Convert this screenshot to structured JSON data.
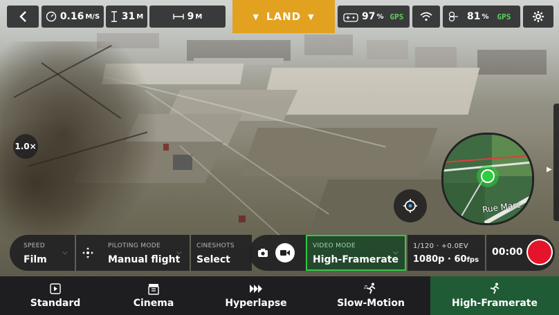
{
  "topbar": {
    "speed_value": "0.16",
    "speed_unit": "M/S",
    "altitude_value": "31",
    "altitude_unit": "M",
    "distance_value": "9",
    "distance_unit": "M",
    "land_label": "LAND",
    "controller_battery": "97",
    "controller_battery_unit": "%",
    "controller_gps": "GPS",
    "drone_battery": "81",
    "drone_battery_unit": "%",
    "drone_gps": "GPS"
  },
  "overlay": {
    "zoom_label": "1.0×",
    "map_street": "Rue Marc"
  },
  "controls": {
    "speed_label": "SPEED",
    "speed_value": "Film",
    "piloting_label": "PILOTING MODE",
    "piloting_value": "Manual flight",
    "cineshots_label": "CINESHOTS",
    "cineshots_value": "Select",
    "video_mode_label": "VIDEO MODE",
    "video_mode_value": "High-Framerate",
    "shutter_ev": "1/120 · +0.0EV",
    "resolution": "1080p · 60",
    "fps_unit": "fps",
    "timer": "00:00"
  },
  "tabs": [
    {
      "label": "Standard",
      "icon": "play-square-icon"
    },
    {
      "label": "Cinema",
      "icon": "clapperboard-icon"
    },
    {
      "label": "Hyperlapse",
      "icon": "fast-forward-icon"
    },
    {
      "label": "Slow-Motion",
      "icon": "runner-icon"
    },
    {
      "label": "High-Framerate",
      "icon": "runner-icon",
      "active": true
    }
  ],
  "colors": {
    "accent_green": "#2ecc40",
    "land_orange": "#e2a21f",
    "record_red": "#e5142a",
    "active_tab": "#1f5b34"
  }
}
